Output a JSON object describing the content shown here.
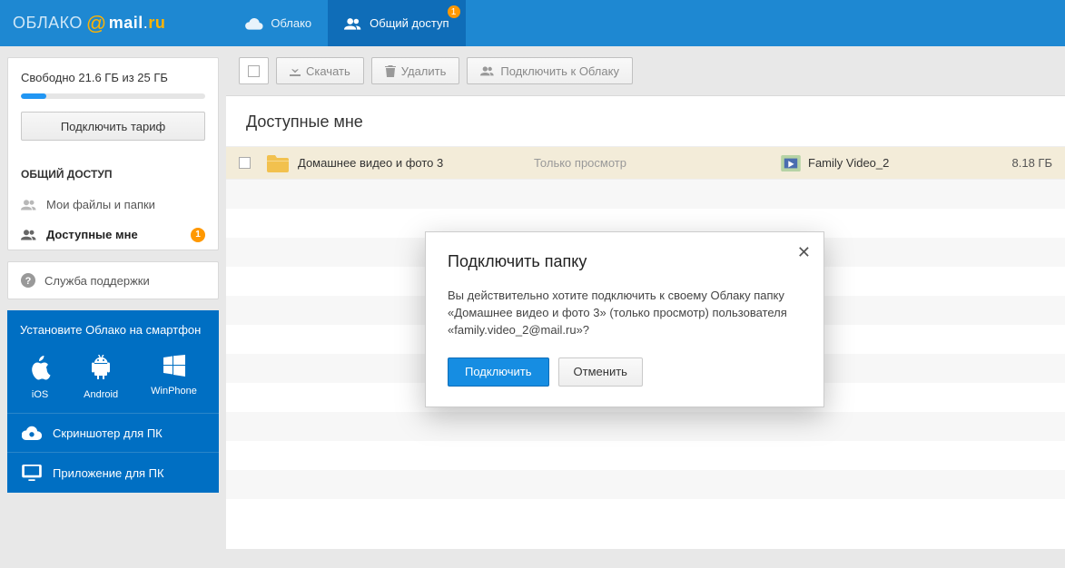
{
  "logo": {
    "oblako": "ОБЛАКО",
    "mail": "mail",
    "ru": "ru"
  },
  "nav": {
    "cloud": "Облако",
    "shared": "Общий доступ",
    "shared_badge": "1"
  },
  "sidebar": {
    "storage_text": "Свободно 21.6 ГБ из 25 ГБ",
    "tariff_btn": "Подключить тариф",
    "section_title": "ОБЩИЙ ДОСТУП",
    "my_files": "Мои файлы и папки",
    "available": "Доступные мне",
    "available_badge": "1",
    "support": "Служба поддержки"
  },
  "promo": {
    "title": "Установите Облако на смартфон",
    "ios": "iOS",
    "android": "Android",
    "winphone": "WinPhone",
    "screenshoter": "Скриншотер для ПК",
    "desktop_app": "Приложение для ПК"
  },
  "toolbar": {
    "download": "Скачать",
    "delete": "Удалить",
    "connect": "Подключить к Облаку"
  },
  "content": {
    "title": "Доступные мне",
    "row": {
      "folder_name": "Домашнее видео и фото 3",
      "perm": "Только просмотр",
      "folder_name2": "Family Video_2",
      "size": "8.18 ГБ"
    }
  },
  "modal": {
    "title": "Подключить папку",
    "body": "Вы действительно хотите подключить к своему Облаку папку «Домашнее видео и фото 3» (только просмотр) пользователя «family.video_2@mail.ru»?",
    "primary": "Подключить",
    "cancel": "Отменить"
  }
}
